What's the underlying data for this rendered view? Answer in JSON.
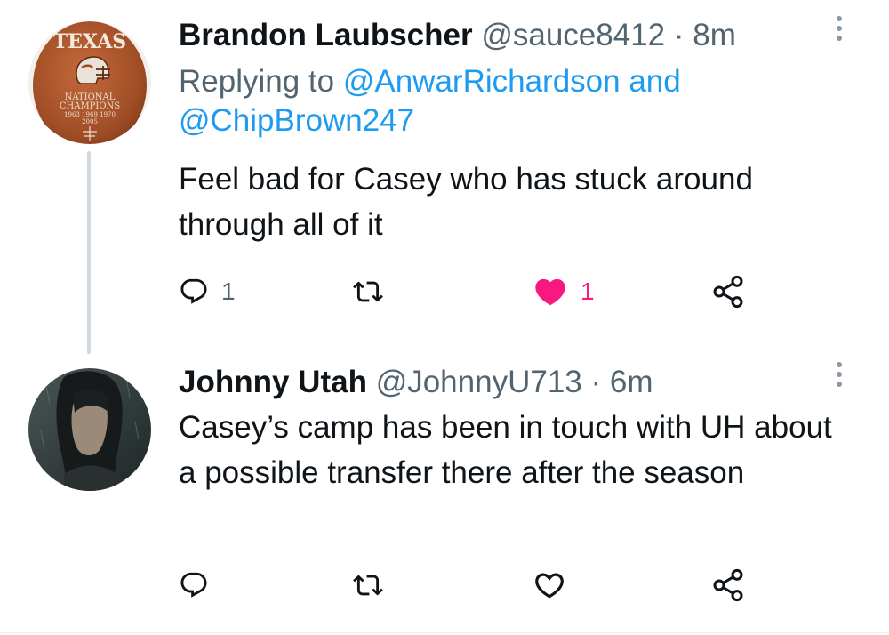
{
  "tweets": [
    {
      "display_name": "Brandon Laubscher",
      "handle": "@sauce8412",
      "separator": "·",
      "time": "8m",
      "replying_prefix": "Replying to ",
      "replying_mention_1": "@AnwarRichardson",
      "replying_and": " and",
      "replying_mention_2": "@ChipBrown247",
      "text": "Feel bad for Casey who has stuck around through all of it",
      "reply_count": "1",
      "retweet_count": "",
      "like_count": "1",
      "liked": true,
      "avatar": {
        "icon": "texas-longhorns-football-avatar",
        "word": "TEXAS",
        "line1": "NATIONAL",
        "line2": "CHAMPIONS",
        "line3": "1963 1969 1970",
        "line4": "2005"
      }
    },
    {
      "display_name": "Johnny Utah",
      "handle": "@JohnnyU713",
      "separator": "·",
      "time": "6m",
      "text": "Casey’s camp has been in touch with UH about a possible transfer there after the season",
      "reply_count": "",
      "retweet_count": "",
      "like_count": "",
      "liked": false,
      "avatar": {
        "icon": "person-in-rain-avatar"
      }
    }
  ],
  "icons": {
    "reply": "reply-icon",
    "retweet": "retweet-icon",
    "like": "heart-icon",
    "share": "share-icon",
    "more": "more-options-icon"
  },
  "colors": {
    "text": "#0f1419",
    "secondary": "#536471",
    "link": "#1d9bf0",
    "like_active": "#f91880",
    "thread_line": "#cfd9de"
  }
}
